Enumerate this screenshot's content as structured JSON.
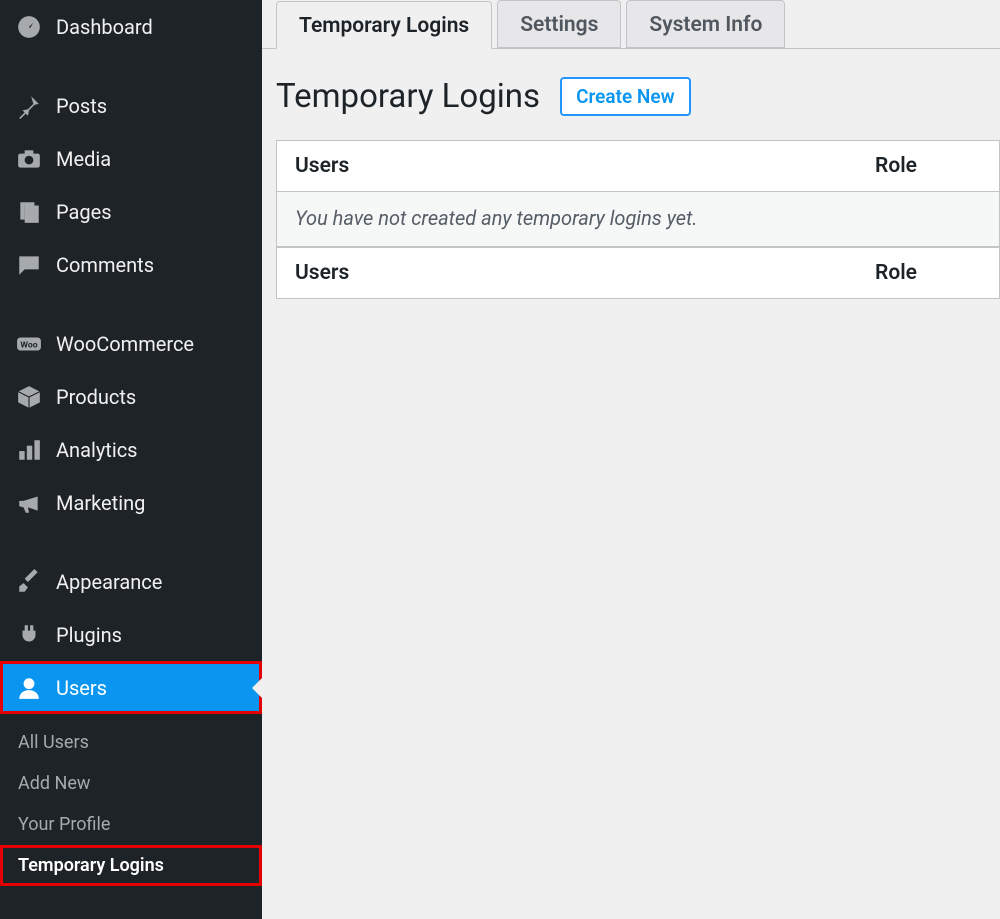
{
  "sidebar": {
    "top": [
      {
        "icon": "dashboard",
        "label": "Dashboard"
      },
      {
        "icon": "pin",
        "label": "Posts"
      },
      {
        "icon": "camera",
        "label": "Media"
      },
      {
        "icon": "pages",
        "label": "Pages"
      },
      {
        "icon": "comment",
        "label": "Comments"
      }
    ],
    "commerce": [
      {
        "icon": "woo",
        "label": "WooCommerce"
      },
      {
        "icon": "box",
        "label": "Products"
      },
      {
        "icon": "bars",
        "label": "Analytics"
      },
      {
        "icon": "mega",
        "label": "Marketing"
      }
    ],
    "admin": [
      {
        "icon": "brush",
        "label": "Appearance"
      },
      {
        "icon": "plug",
        "label": "Plugins"
      },
      {
        "icon": "user",
        "label": "Users",
        "active": true
      }
    ],
    "submenu": [
      "All Users",
      "Add New",
      "Your Profile",
      "Temporary Logins"
    ],
    "submenu_current": 3
  },
  "tabs": [
    "Temporary Logins",
    "Settings",
    "System Info"
  ],
  "tabs_active": 0,
  "page": {
    "title": "Temporary Logins",
    "create_label": "Create New"
  },
  "table": {
    "col_users": "Users",
    "col_role": "Role",
    "empty_msg": "You have not created any temporary logins yet."
  }
}
